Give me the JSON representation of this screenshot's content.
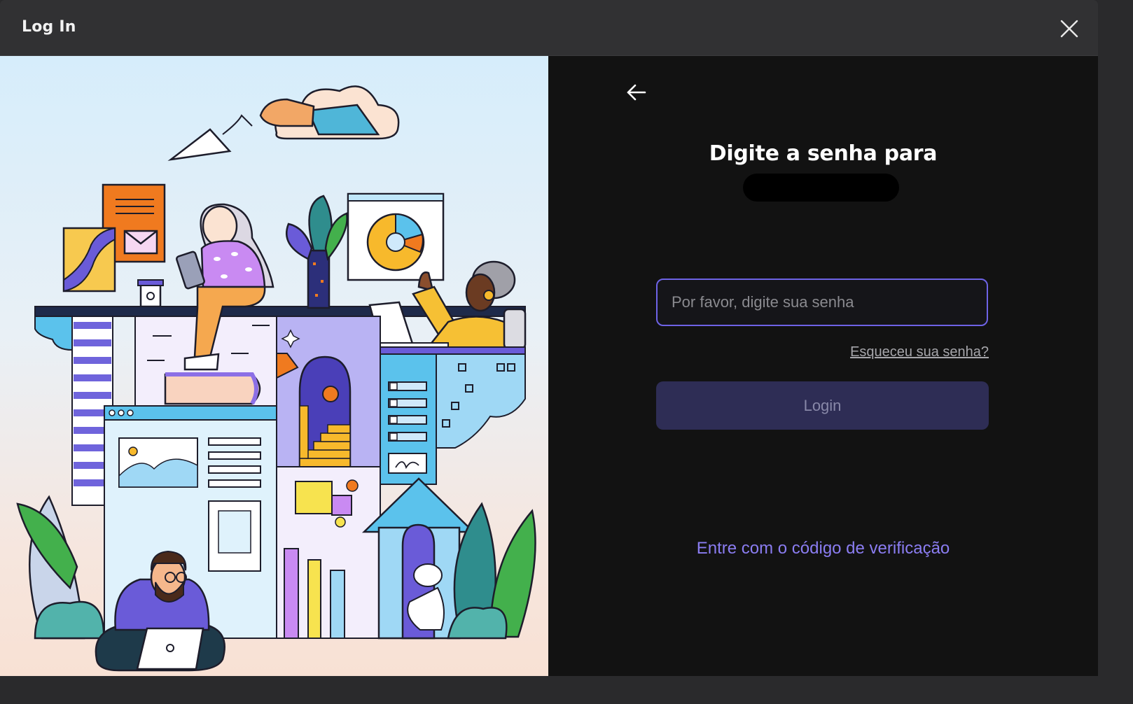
{
  "window": {
    "title": "Log In"
  },
  "icons": {
    "close": "close-icon",
    "back": "arrow-left-icon"
  },
  "login": {
    "heading": "Digite a senha para",
    "password_placeholder": "Por favor, digite sua senha",
    "password_value": "",
    "forgot_label": "Esqueceu sua senha?",
    "login_label": "Login",
    "verification_link": "Entre com o código de verificação"
  },
  "colors": {
    "accent": "#6e63e6",
    "link": "#8b7df2",
    "button_disabled": "#2e2d55",
    "panel_bg": "#121212"
  }
}
